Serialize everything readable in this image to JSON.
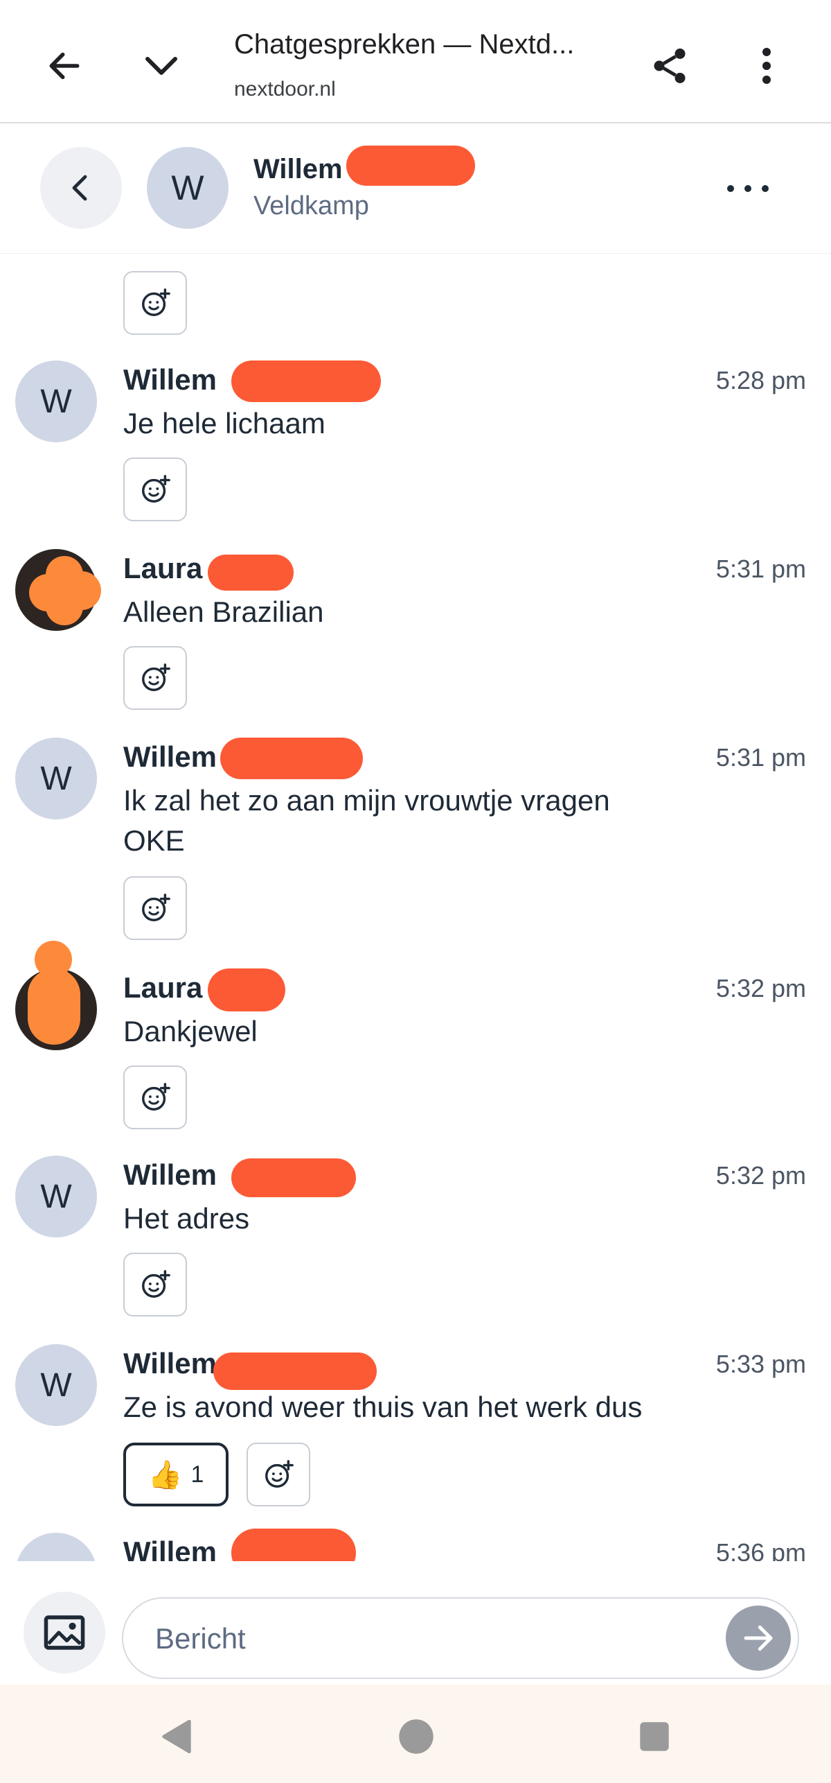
{
  "browser": {
    "title": "Chatgesprekken — Nextd...",
    "url": "nextdoor.nl"
  },
  "chat_header": {
    "name": "Willem",
    "subtitle": "Veldkamp",
    "avatar_initial": "W"
  },
  "messages": [
    {
      "sender": "Willem",
      "initial": "W",
      "time": "5:28 pm",
      "text": "Je hele lichaam",
      "avatar": "initial"
    },
    {
      "sender": "Laura",
      "initial": "",
      "time": "5:31 pm",
      "text": "Alleen Brazilian",
      "avatar": "photo"
    },
    {
      "sender": "Willem",
      "initial": "W",
      "time": "5:31 pm",
      "text": "Ik zal het zo aan mijn vrouwtje vragen",
      "text2": "OKE",
      "avatar": "initial"
    },
    {
      "sender": "Laura",
      "initial": "",
      "time": "5:32 pm",
      "text": "Dankjewel",
      "avatar": "photo"
    },
    {
      "sender": "Willem",
      "initial": "W",
      "time": "5:32 pm",
      "text": "Het adres",
      "avatar": "initial"
    },
    {
      "sender": "Willem",
      "initial": "W",
      "time": "5:33 pm",
      "text": "Ze is avond weer thuis van het werk dus",
      "avatar": "initial",
      "reaction": {
        "emoji": "👍",
        "count": "1"
      }
    },
    {
      "sender": "Willem",
      "initial": "W",
      "time": "5:36 pm",
      "text": "",
      "avatar": "initial"
    }
  ],
  "composer": {
    "placeholder": "Bericht"
  },
  "colors": {
    "redaction": "#fc5a35",
    "avatar_bg": "#cfd6e6",
    "send_button": "#9aa1ac"
  },
  "icons": {
    "browser_back": "arrow-left-icon",
    "browser_collapse": "chevron-down-icon",
    "share": "share-icon",
    "menu": "more-vertical-icon",
    "chat_back": "chevron-left-icon",
    "chat_more": "more-horizontal-icon",
    "add_reaction": "add-reaction-icon",
    "image": "image-icon",
    "send": "arrow-right-icon"
  }
}
